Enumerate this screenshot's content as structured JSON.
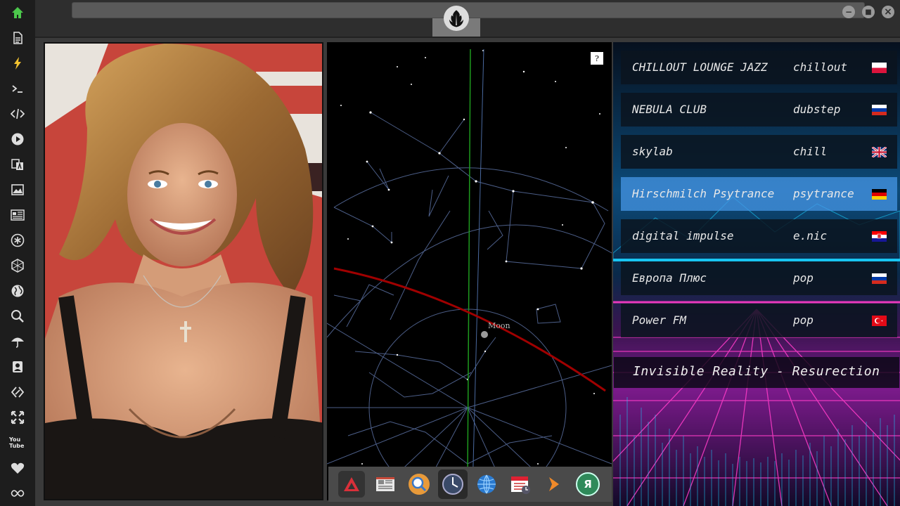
{
  "sidebar": {
    "icons": [
      "home-icon",
      "document-icon",
      "lightning-icon",
      "terminal-icon",
      "code-icon",
      "play-icon",
      "translate-icon",
      "image-icon",
      "news-icon",
      "asterisk-icon",
      "hexagon-icon",
      "globe-icon",
      "search-icon",
      "umbrella-icon",
      "contact-icon",
      "link-icon",
      "expand-icon",
      "youtube-icon",
      "heart-icon",
      "infinity-icon"
    ],
    "youtube_label": "You Tube"
  },
  "window": {
    "minimize": "−",
    "maximize": "■",
    "close": "×"
  },
  "sky_map": {
    "help_label": "?",
    "moon_label": "Moon"
  },
  "dock": {
    "items": [
      "arrow-app-icon",
      "news-app-icon",
      "search-app-icon",
      "clock-app-icon",
      "globe-app-icon",
      "calendar-app-icon",
      "forward-app-icon",
      "yandex-app-icon"
    ],
    "yandex_label": "Я"
  },
  "radio": {
    "stations": [
      {
        "name": "CHILLOUT LOUNGE JAZZ",
        "genre": "chillout",
        "flag": "pl"
      },
      {
        "name": "NEBULA CLUB",
        "genre": "dubstep",
        "flag": "ru"
      },
      {
        "name": "skylab",
        "genre": "chill",
        "flag": "gb"
      },
      {
        "name": "Hirschmilch Psytrance",
        "genre": "psytrance",
        "flag": "de"
      },
      {
        "name": "digital impulse",
        "genre": "e.nic",
        "flag": "hr"
      },
      {
        "name": "Европа Плюс",
        "genre": "pop",
        "flag": "ru"
      },
      {
        "name": "Power FM",
        "genre": "pop",
        "flag": "tr"
      }
    ],
    "active_index": 3,
    "now_playing": "Invisible Reality - Resurection"
  },
  "colors": {
    "accent_active": "#4696e6",
    "sidebar_bg": "#1d1d1d",
    "neon_pink": "#ff3cc8",
    "neon_cyan": "#1ad2ff"
  }
}
